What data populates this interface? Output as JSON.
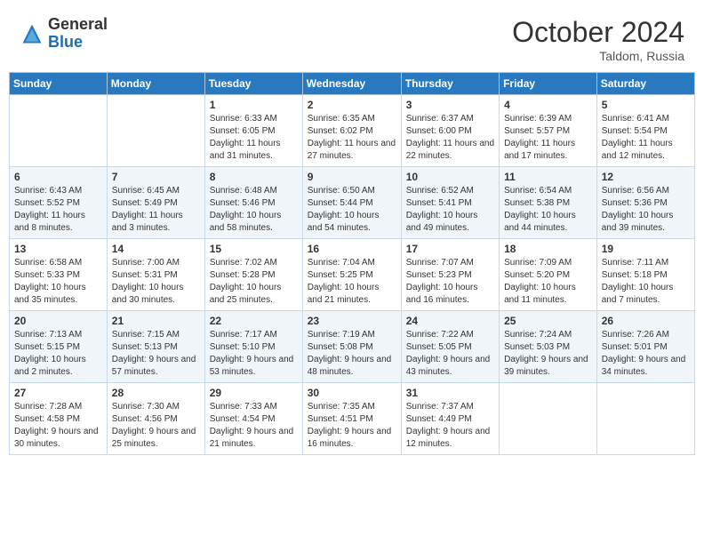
{
  "header": {
    "logo": {
      "general": "General",
      "blue": "Blue"
    },
    "month": "October 2024",
    "location": "Taldom, Russia"
  },
  "weekdays": [
    "Sunday",
    "Monday",
    "Tuesday",
    "Wednesday",
    "Thursday",
    "Friday",
    "Saturday"
  ],
  "weeks": [
    [
      {
        "day": null,
        "info": null
      },
      {
        "day": null,
        "info": null
      },
      {
        "day": "1",
        "info": "Sunrise: 6:33 AM\nSunset: 6:05 PM\nDaylight: 11 hours and 31 minutes."
      },
      {
        "day": "2",
        "info": "Sunrise: 6:35 AM\nSunset: 6:02 PM\nDaylight: 11 hours and 27 minutes."
      },
      {
        "day": "3",
        "info": "Sunrise: 6:37 AM\nSunset: 6:00 PM\nDaylight: 11 hours and 22 minutes."
      },
      {
        "day": "4",
        "info": "Sunrise: 6:39 AM\nSunset: 5:57 PM\nDaylight: 11 hours and 17 minutes."
      },
      {
        "day": "5",
        "info": "Sunrise: 6:41 AM\nSunset: 5:54 PM\nDaylight: 11 hours and 12 minutes."
      }
    ],
    [
      {
        "day": "6",
        "info": "Sunrise: 6:43 AM\nSunset: 5:52 PM\nDaylight: 11 hours and 8 minutes."
      },
      {
        "day": "7",
        "info": "Sunrise: 6:45 AM\nSunset: 5:49 PM\nDaylight: 11 hours and 3 minutes."
      },
      {
        "day": "8",
        "info": "Sunrise: 6:48 AM\nSunset: 5:46 PM\nDaylight: 10 hours and 58 minutes."
      },
      {
        "day": "9",
        "info": "Sunrise: 6:50 AM\nSunset: 5:44 PM\nDaylight: 10 hours and 54 minutes."
      },
      {
        "day": "10",
        "info": "Sunrise: 6:52 AM\nSunset: 5:41 PM\nDaylight: 10 hours and 49 minutes."
      },
      {
        "day": "11",
        "info": "Sunrise: 6:54 AM\nSunset: 5:38 PM\nDaylight: 10 hours and 44 minutes."
      },
      {
        "day": "12",
        "info": "Sunrise: 6:56 AM\nSunset: 5:36 PM\nDaylight: 10 hours and 39 minutes."
      }
    ],
    [
      {
        "day": "13",
        "info": "Sunrise: 6:58 AM\nSunset: 5:33 PM\nDaylight: 10 hours and 35 minutes."
      },
      {
        "day": "14",
        "info": "Sunrise: 7:00 AM\nSunset: 5:31 PM\nDaylight: 10 hours and 30 minutes."
      },
      {
        "day": "15",
        "info": "Sunrise: 7:02 AM\nSunset: 5:28 PM\nDaylight: 10 hours and 25 minutes."
      },
      {
        "day": "16",
        "info": "Sunrise: 7:04 AM\nSunset: 5:25 PM\nDaylight: 10 hours and 21 minutes."
      },
      {
        "day": "17",
        "info": "Sunrise: 7:07 AM\nSunset: 5:23 PM\nDaylight: 10 hours and 16 minutes."
      },
      {
        "day": "18",
        "info": "Sunrise: 7:09 AM\nSunset: 5:20 PM\nDaylight: 10 hours and 11 minutes."
      },
      {
        "day": "19",
        "info": "Sunrise: 7:11 AM\nSunset: 5:18 PM\nDaylight: 10 hours and 7 minutes."
      }
    ],
    [
      {
        "day": "20",
        "info": "Sunrise: 7:13 AM\nSunset: 5:15 PM\nDaylight: 10 hours and 2 minutes."
      },
      {
        "day": "21",
        "info": "Sunrise: 7:15 AM\nSunset: 5:13 PM\nDaylight: 9 hours and 57 minutes."
      },
      {
        "day": "22",
        "info": "Sunrise: 7:17 AM\nSunset: 5:10 PM\nDaylight: 9 hours and 53 minutes."
      },
      {
        "day": "23",
        "info": "Sunrise: 7:19 AM\nSunset: 5:08 PM\nDaylight: 9 hours and 48 minutes."
      },
      {
        "day": "24",
        "info": "Sunrise: 7:22 AM\nSunset: 5:05 PM\nDaylight: 9 hours and 43 minutes."
      },
      {
        "day": "25",
        "info": "Sunrise: 7:24 AM\nSunset: 5:03 PM\nDaylight: 9 hours and 39 minutes."
      },
      {
        "day": "26",
        "info": "Sunrise: 7:26 AM\nSunset: 5:01 PM\nDaylight: 9 hours and 34 minutes."
      }
    ],
    [
      {
        "day": "27",
        "info": "Sunrise: 7:28 AM\nSunset: 4:58 PM\nDaylight: 9 hours and 30 minutes."
      },
      {
        "day": "28",
        "info": "Sunrise: 7:30 AM\nSunset: 4:56 PM\nDaylight: 9 hours and 25 minutes."
      },
      {
        "day": "29",
        "info": "Sunrise: 7:33 AM\nSunset: 4:54 PM\nDaylight: 9 hours and 21 minutes."
      },
      {
        "day": "30",
        "info": "Sunrise: 7:35 AM\nSunset: 4:51 PM\nDaylight: 9 hours and 16 minutes."
      },
      {
        "day": "31",
        "info": "Sunrise: 7:37 AM\nSunset: 4:49 PM\nDaylight: 9 hours and 12 minutes."
      },
      {
        "day": null,
        "info": null
      },
      {
        "day": null,
        "info": null
      }
    ]
  ]
}
